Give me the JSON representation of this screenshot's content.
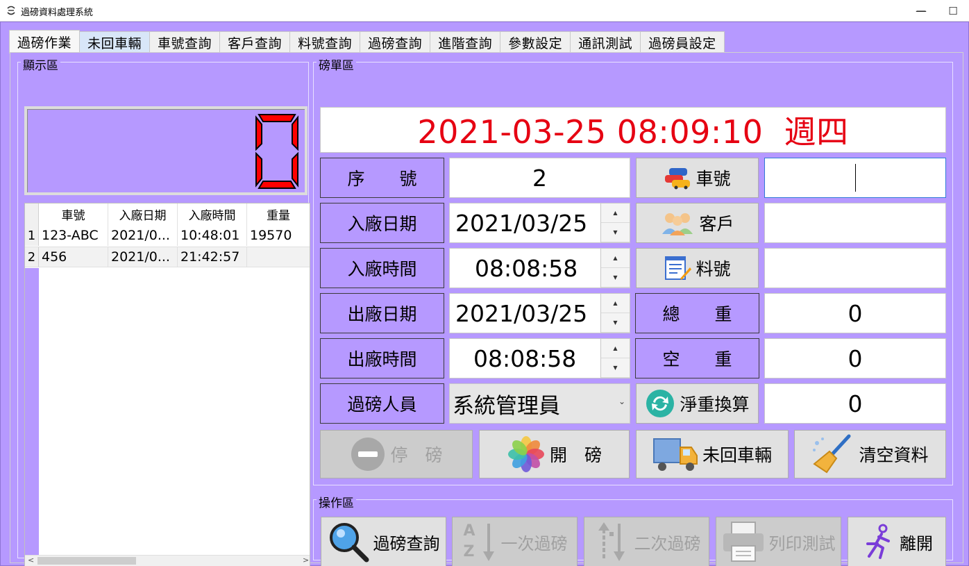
{
  "window": {
    "title": "過磅資料處理系統",
    "controls": {
      "minimize": "—",
      "maximize": "☐",
      "close": "✕"
    }
  },
  "tabs": [
    {
      "label": "過磅作業",
      "state": "active"
    },
    {
      "label": "未回車輛",
      "state": "highlight"
    },
    {
      "label": "車號查詢",
      "state": ""
    },
    {
      "label": "客戶查詢",
      "state": ""
    },
    {
      "label": "料號查詢",
      "state": ""
    },
    {
      "label": "過磅查詢",
      "state": ""
    },
    {
      "label": "進階查詢",
      "state": ""
    },
    {
      "label": "參數設定",
      "state": ""
    },
    {
      "label": "通訊測試",
      "state": ""
    },
    {
      "label": "過磅員設定",
      "state": ""
    }
  ],
  "display_area": {
    "label": "顯示區",
    "scale_reading": "0",
    "grid": {
      "columns": [
        "車號",
        "入廠日期",
        "入廠時間",
        "重量"
      ],
      "rows": [
        {
          "index": "1",
          "plate": "123-ABC",
          "date": "2021/0...",
          "time": "10:48:01",
          "weight": "19570"
        },
        {
          "index": "2",
          "plate": "456",
          "date": "2021/0...",
          "time": "21:42:57",
          "weight": ""
        }
      ],
      "scroll_left": "<",
      "scroll_right": ">"
    }
  },
  "slip_area": {
    "label": "磅單區",
    "datetime": "2021-03-25 08:09:10  週四",
    "fields": {
      "serial_label": "序　　號",
      "serial_value": "2",
      "in_date_label": "入廠日期",
      "in_date_value": "2021/03/25",
      "in_time_label": "入廠時間",
      "in_time_value": "08:08:58",
      "out_date_label": "出廠日期",
      "out_date_value": "2021/03/25",
      "out_time_label": "出廠時間",
      "out_time_value": "08:08:58",
      "operator_label": "過磅人員",
      "operator_value": "系統管理員",
      "plate_button": "車號",
      "plate_value": "",
      "customer_button": "客戶",
      "customer_value": "",
      "material_button": "料號",
      "material_value": "",
      "gross_label": "總　　重",
      "gross_value": "0",
      "tare_label": "空　　重",
      "tare_value": "0",
      "net_button": "淨重換算",
      "net_value": "0"
    },
    "spin_up": "▲",
    "spin_down": "▼",
    "combo_caret": "⌄",
    "buttons": {
      "stop": "停　磅",
      "start": "開　磅",
      "unreturned": "未回車輛",
      "clear": "清空資料"
    }
  },
  "operation_area": {
    "label": "操作區",
    "buttons": {
      "query": "過磅查詢",
      "first": "一次過磅",
      "second": "二次過磅",
      "print": "列印測試",
      "exit": "離開"
    },
    "az_top": "A",
    "az_bottom": "Z"
  },
  "colors": {
    "panel": "#b699ff",
    "accent_red": "#e60012",
    "lcd_red": "#ff0000"
  }
}
